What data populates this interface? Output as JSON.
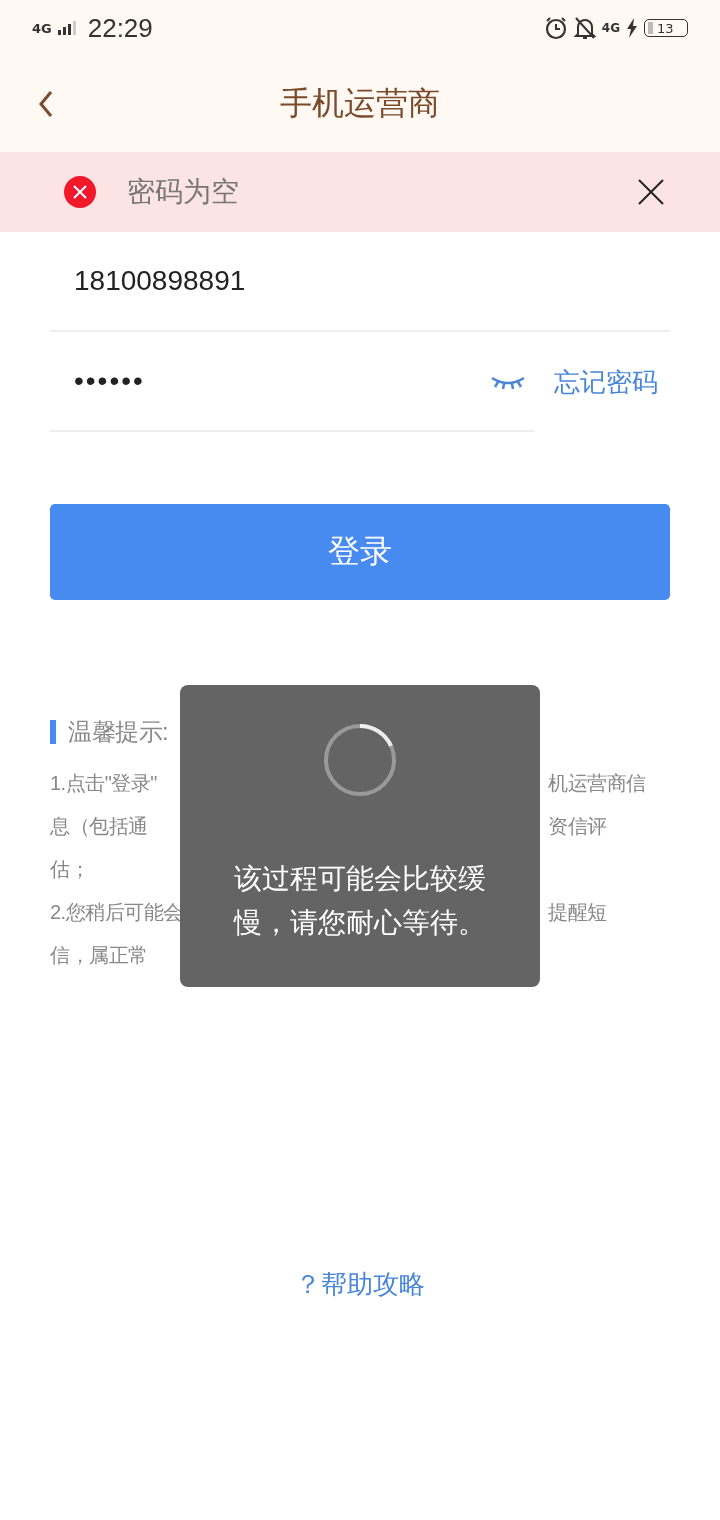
{
  "status_bar": {
    "network": "4G",
    "time": "22:29",
    "mobile_data": "4G",
    "battery": "13"
  },
  "header": {
    "title": "手机运营商"
  },
  "error_banner": {
    "message": "密码为空"
  },
  "form": {
    "phone": "18100898891",
    "password": "••••••",
    "password_visible": false,
    "forgot_link": "忘记密码",
    "login_button": "登录"
  },
  "tips": {
    "title": "温馨提示:",
    "lines": [
      {
        "left": "1.点击\"登录\"",
        "right": "机运营商信"
      },
      {
        "left": "息（包括通",
        "right": "资信评"
      },
      {
        "left": "估；"
      },
      {
        "left": "2.您稍后可能会",
        "right": "提醒短"
      },
      {
        "left": "信，属正常"
      }
    ]
  },
  "loading_toast": {
    "message": "该过程可能会比较缓慢，请您耐心等待。"
  },
  "help_link": "？帮助攻略"
}
